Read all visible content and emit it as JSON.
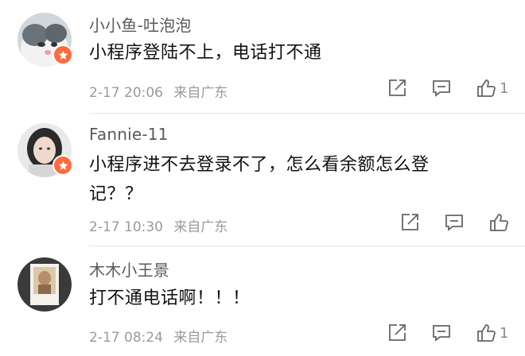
{
  "comments": [
    {
      "username": "小小鱼-吐泡泡",
      "text": "小程序登陆不上，电话打不通",
      "date": "2-17",
      "time": "20:06",
      "source": "来自广东",
      "like_count": "1",
      "avatar_icon": "cat-avatar",
      "badge_icon": "star-badge-icon"
    },
    {
      "username": "Fannie-11",
      "text": "小程序进不去登录不了，怎么看余额怎么登记？？",
      "date": "2-17",
      "time": "10:30",
      "source": "来自广东",
      "like_count": "",
      "avatar_icon": "girl-avatar",
      "badge_icon": "star-badge-icon"
    },
    {
      "username": "木木小王景",
      "text": "打不通电话啊！！！",
      "date": "2-17",
      "time": "08:24",
      "source": "来自广东",
      "like_count": "1",
      "avatar_icon": "photo-avatar",
      "badge_icon": ""
    }
  ],
  "colors": {
    "badge": "#ff6a3d",
    "username": "#5a5a5a",
    "meta": "#9a9a9a",
    "text": "#111111",
    "divider": "#e6e6e6"
  }
}
